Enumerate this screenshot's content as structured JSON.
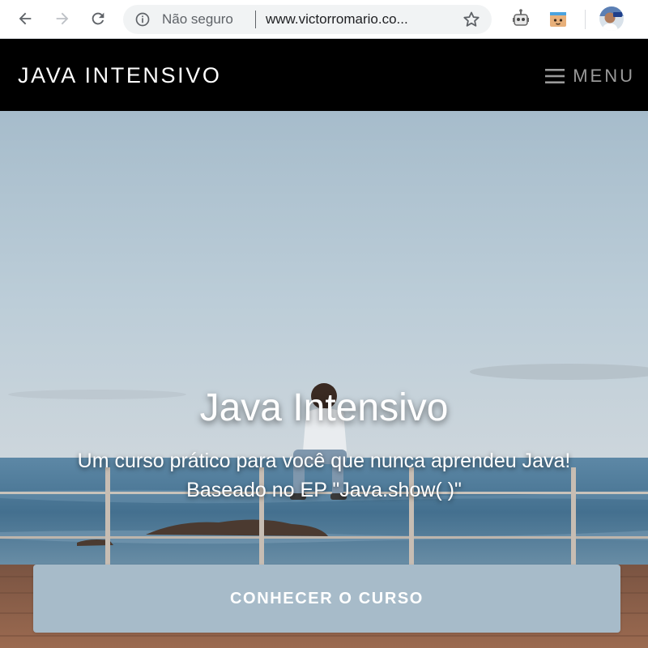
{
  "browser": {
    "security_label": "Não seguro",
    "url": "www.victorromario.co...",
    "icons": {
      "back": "back-arrow-icon",
      "forward": "forward-arrow-icon",
      "reload": "reload-icon",
      "info": "info-icon",
      "bookmark": "star-icon",
      "extension1": "robot-extension-icon",
      "extension2": "box-extension-icon",
      "profile": "avatar"
    }
  },
  "header": {
    "brand": "JAVA INTENSIVO",
    "menu_label": "MENU",
    "menu_icon": "hamburger-icon"
  },
  "hero": {
    "title": "Java Intensivo",
    "subtitle_line1": "Um curso prático para você que nunca aprendeu Java!",
    "subtitle_line2": "Baseado no EP \"Java.show( )\"",
    "cta_label": "CONHECER O CURSO"
  },
  "colors": {
    "header_bg": "#000000",
    "brand_text": "#ffffff",
    "menu_text": "#9a9a9a",
    "cta_bg": "#a7bbc9",
    "sky": "#b6c9d6",
    "sea": "#3f6d8c",
    "deck": "#8a5a44"
  }
}
